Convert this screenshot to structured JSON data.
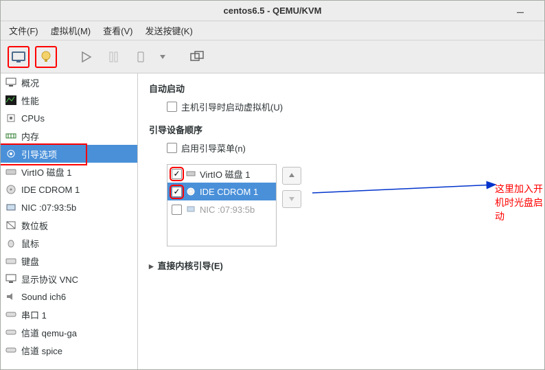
{
  "title": "centos6.5 - QEMU/KVM",
  "menu": {
    "file": "文件(F)",
    "vm": "虚拟机(M)",
    "view": "查看(V)",
    "sendkey": "发送按键(K)"
  },
  "sidebar": {
    "items": [
      {
        "label": "概况"
      },
      {
        "label": "性能"
      },
      {
        "label": "CPUs"
      },
      {
        "label": "内存"
      },
      {
        "label": "引导选项"
      },
      {
        "label": "VirtIO 磁盘 1"
      },
      {
        "label": "IDE CDROM 1"
      },
      {
        "label": "NIC :07:93:5b"
      },
      {
        "label": "数位板"
      },
      {
        "label": "鼠标"
      },
      {
        "label": "键盘"
      },
      {
        "label": "显示协议 VNC"
      },
      {
        "label": "Sound ich6"
      },
      {
        "label": "串口 1"
      },
      {
        "label": "信道 qemu-ga"
      },
      {
        "label": "信道 spice"
      }
    ]
  },
  "main": {
    "autostart_title": "自动启动",
    "autostart_label": "主机引导时启动虚拟机(U)",
    "bootorder_title": "引导设备顺序",
    "bootmenu_label": "启用引导菜单(n)",
    "boot_items": [
      {
        "label": "VirtIO 磁盘 1",
        "checked": true
      },
      {
        "label": "IDE CDROM 1",
        "checked": true,
        "selected": true
      },
      {
        "label": "NIC :07:93:5b",
        "checked": false,
        "dim": true
      }
    ],
    "kernel_label": "直接内核引导(E)"
  },
  "annotation": "这里加入开机时光盘启动"
}
